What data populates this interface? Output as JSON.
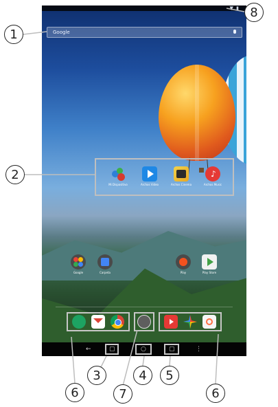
{
  "search": {
    "label": "Google"
  },
  "status": {
    "icons": "▼ ▮"
  },
  "app_group": [
    {
      "label": "Mi Dispositivo",
      "icon": "balls-icon"
    },
    {
      "label": "Archos Video",
      "icon": "play-icon"
    },
    {
      "label": "Archos Cinema",
      "icon": "cinema-icon"
    },
    {
      "label": "Archos Music",
      "icon": "music-icon"
    }
  ],
  "home_apps": [
    {
      "label": "Google",
      "icon": "google-folder-icon"
    },
    {
      "label": "Carpeta",
      "icon": "folder-icon"
    },
    {
      "label": "Play",
      "icon": "play-folder-icon"
    },
    {
      "label": "Play Store",
      "icon": "play-store-icon"
    }
  ],
  "dock_left": [
    "hangouts-icon",
    "gmail-icon",
    "chrome-icon"
  ],
  "dock_right": [
    "youtube-icon",
    "photos-icon",
    "music-icon"
  ],
  "nav": {
    "back": "←",
    "recents": "▢",
    "home": "○",
    "menu": "▢",
    "overflow": "⋮"
  },
  "callouts": [
    "1",
    "2",
    "3",
    "4",
    "5",
    "6",
    "7",
    "6",
    "8"
  ]
}
